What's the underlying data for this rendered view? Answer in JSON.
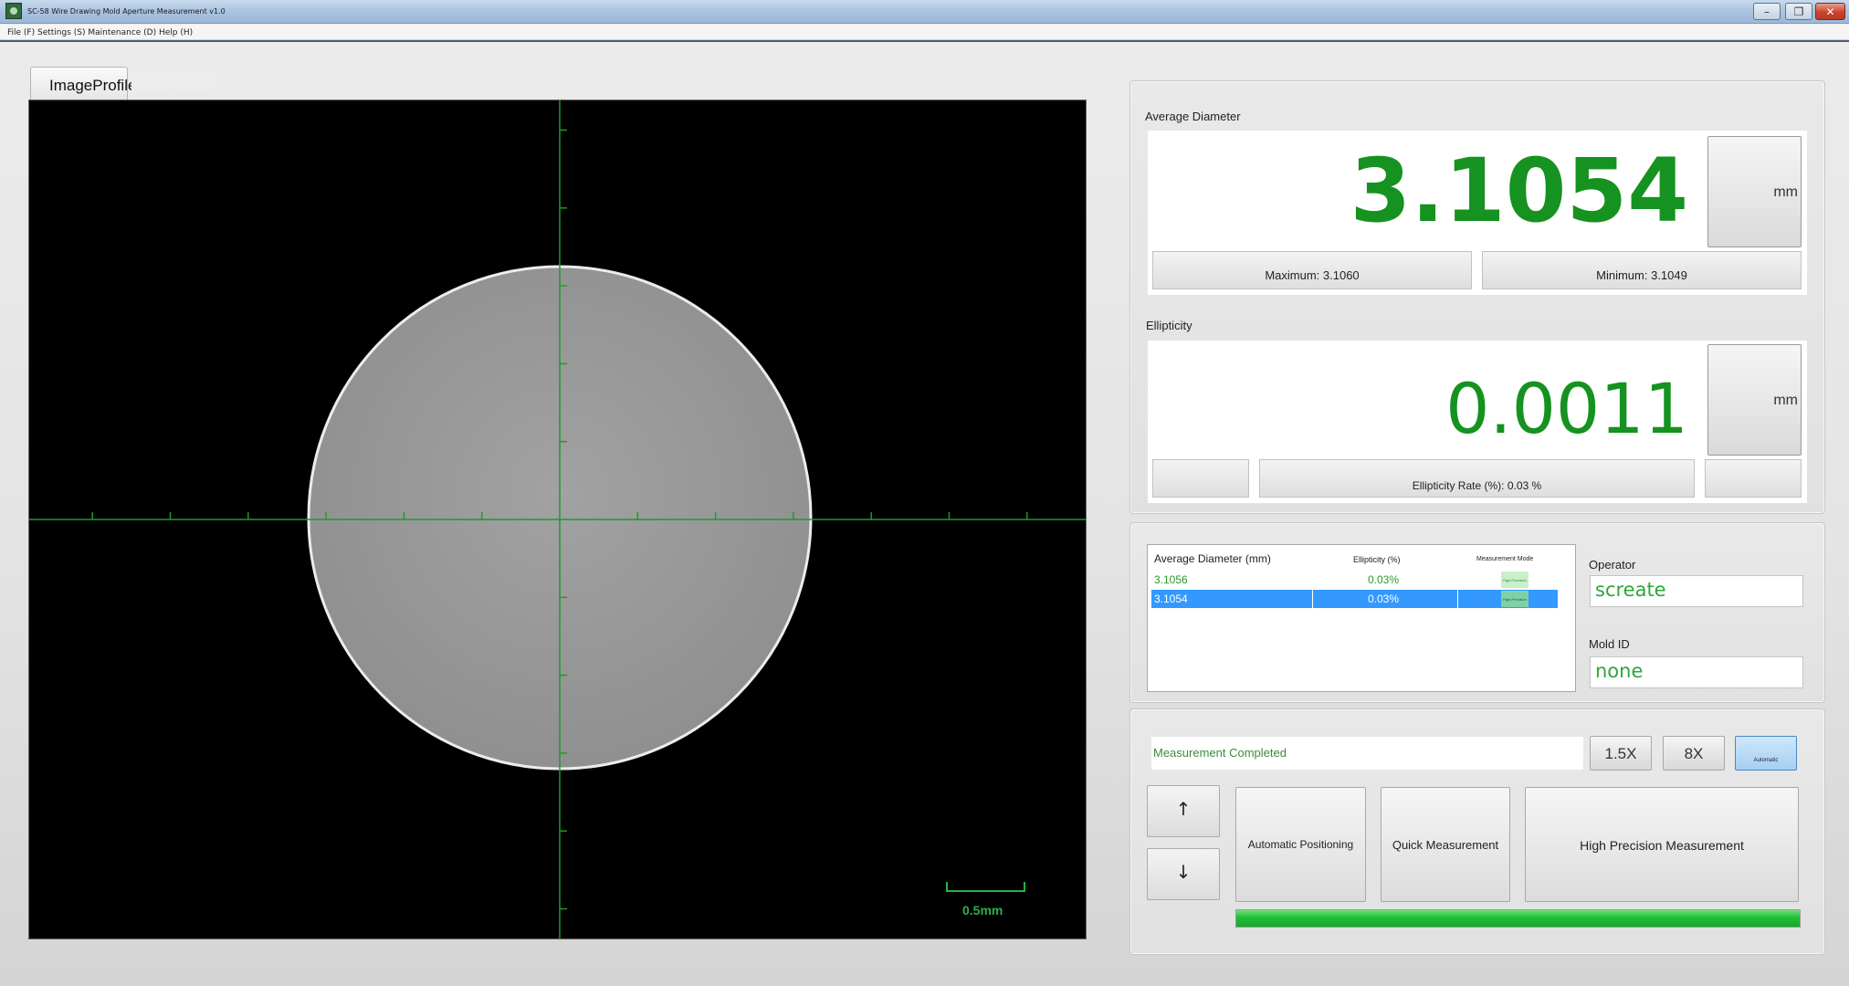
{
  "window": {
    "title": "SC-58 Wire Drawing Mold Aperture Measurement v1.0",
    "minimize_icon": "minimize-icon",
    "maximize_icon": "maximize-icon",
    "close_label": "✕"
  },
  "menubar": {
    "text": "File (F) Settings (S) Maintenance (D) Help (H)"
  },
  "tabs": [
    {
      "label": "ImageProfile"
    }
  ],
  "viewer": {
    "scale_bar_label": "0.5mm",
    "crosshair_color": "#1f9a2a",
    "background_color": "#000000",
    "circle_fill": "#9a9a9a",
    "circle_edge": "#e8e8e8"
  },
  "avg_diameter": {
    "label": "Average Diameter",
    "value": "3.1054",
    "unit": "mm",
    "max_text": "Maximum: 3.1060",
    "min_text": "Minimum: 3.1049",
    "value_color": "#15921f"
  },
  "ellipticity": {
    "label": "Ellipticity",
    "value": "0.0011",
    "unit": "mm",
    "rate_text": "Ellipticity Rate (%): 0.03 %"
  },
  "history": {
    "columns": [
      "Average Diameter (mm)",
      "Ellipticity (%)",
      "Measurement Mode"
    ],
    "rows": [
      {
        "diameter": "3.1056",
        "ellipticity": "0.03%",
        "mode": "High Precision",
        "selected": false
      },
      {
        "diameter": "3.1054",
        "ellipticity": "0.03%",
        "mode": "High Precision",
        "selected": true
      }
    ],
    "selected_color": "#3399ff"
  },
  "operator": {
    "label": "Operator",
    "value": "screate"
  },
  "mold_id": {
    "label": "Mold ID",
    "value": "none"
  },
  "controls": {
    "status": "Measurement Completed",
    "zoom_options": [
      "1.5X",
      "8X"
    ],
    "auto_label": "Automatic",
    "up_arrow": "↑",
    "down_arrow": "↓",
    "auto_positioning": "Automatic Positioning",
    "quick_measurement": "Quick Measurement",
    "high_precision": "High Precision Measurement",
    "progress_percent": 100
  }
}
